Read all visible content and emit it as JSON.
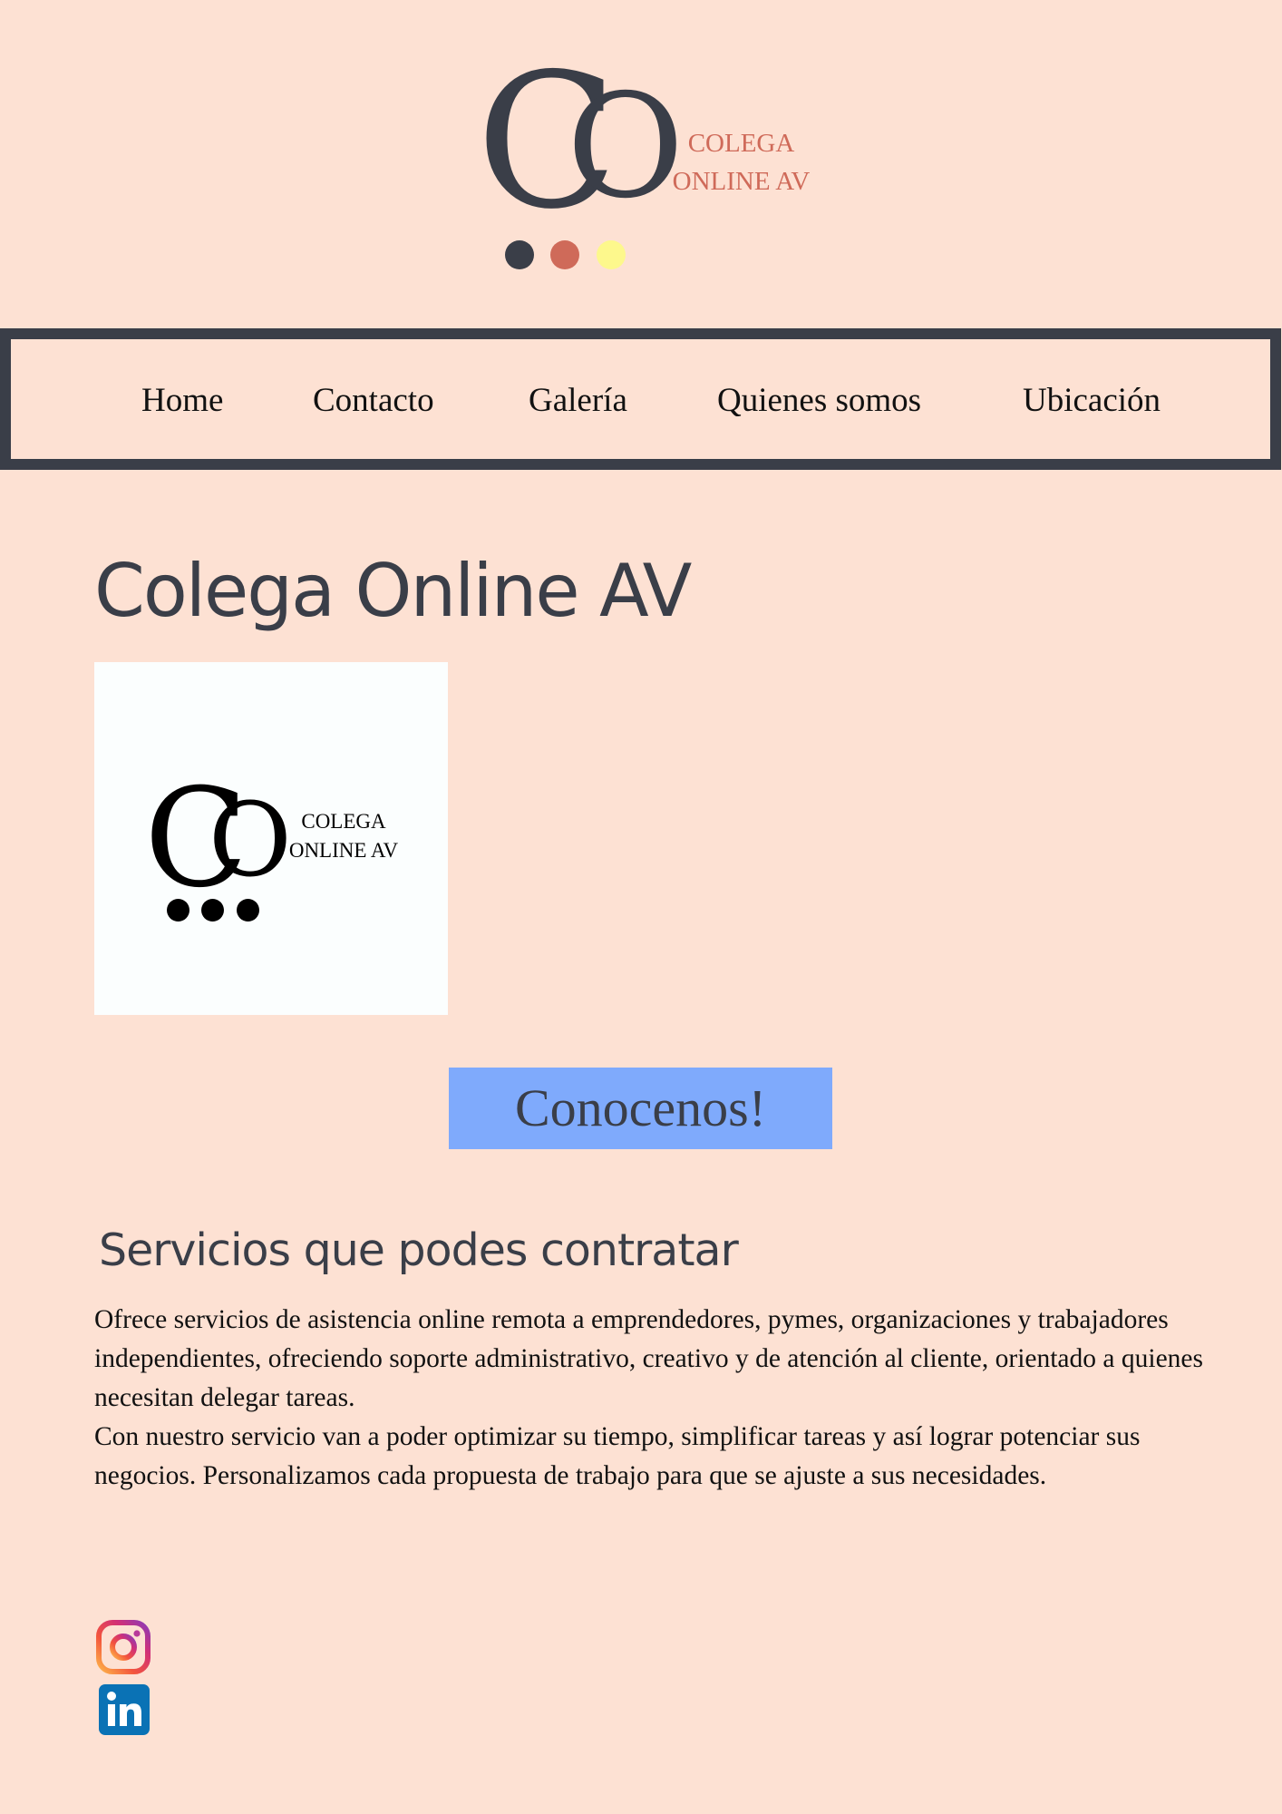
{
  "header": {
    "logo": {
      "mark_c": "C",
      "mark_o": "O",
      "line1": "COLEGA",
      "line2": "ONLINE AV",
      "dot_colors": [
        "#3a3e48",
        "#cf6a59",
        "#fdf88c"
      ]
    }
  },
  "nav": {
    "items": [
      {
        "label": "Home"
      },
      {
        "label": "Contacto"
      },
      {
        "label": "Galería"
      },
      {
        "label": "Quienes somos"
      },
      {
        "label": "Ubicación"
      }
    ]
  },
  "main": {
    "title": "Colega Online AV",
    "logo_image": {
      "mark_c": "C",
      "mark_o": "O",
      "line1": "COLEGA",
      "line2": "ONLINE AV"
    },
    "cta_label": "Conocenos!"
  },
  "services": {
    "title": "Servicios que podes contratar",
    "paragraphs": [
      "Ofrece servicios de asistencia online remota a emprendedores, pymes, organizaciones y trabajadores independientes, ofreciendo soporte administrativo, creativo y de atención al cliente, orientado a quienes necesitan delegar tareas.",
      "Con nuestro servicio van a poder optimizar su tiempo, simplificar tareas y así lograr potenciar sus negocios. Personalizamos cada propuesta de trabajo para que se ajuste a sus necesidades."
    ]
  },
  "social": {
    "icons": [
      "instagram-icon",
      "linkedin-icon"
    ]
  },
  "colors": {
    "background": "#fde1d3",
    "dark": "#3a3e48",
    "accent_coral": "#cf6a59",
    "accent_yellow": "#fdf88c",
    "button_blue": "#7faafc",
    "linkedin_blue": "#0a72b5"
  }
}
